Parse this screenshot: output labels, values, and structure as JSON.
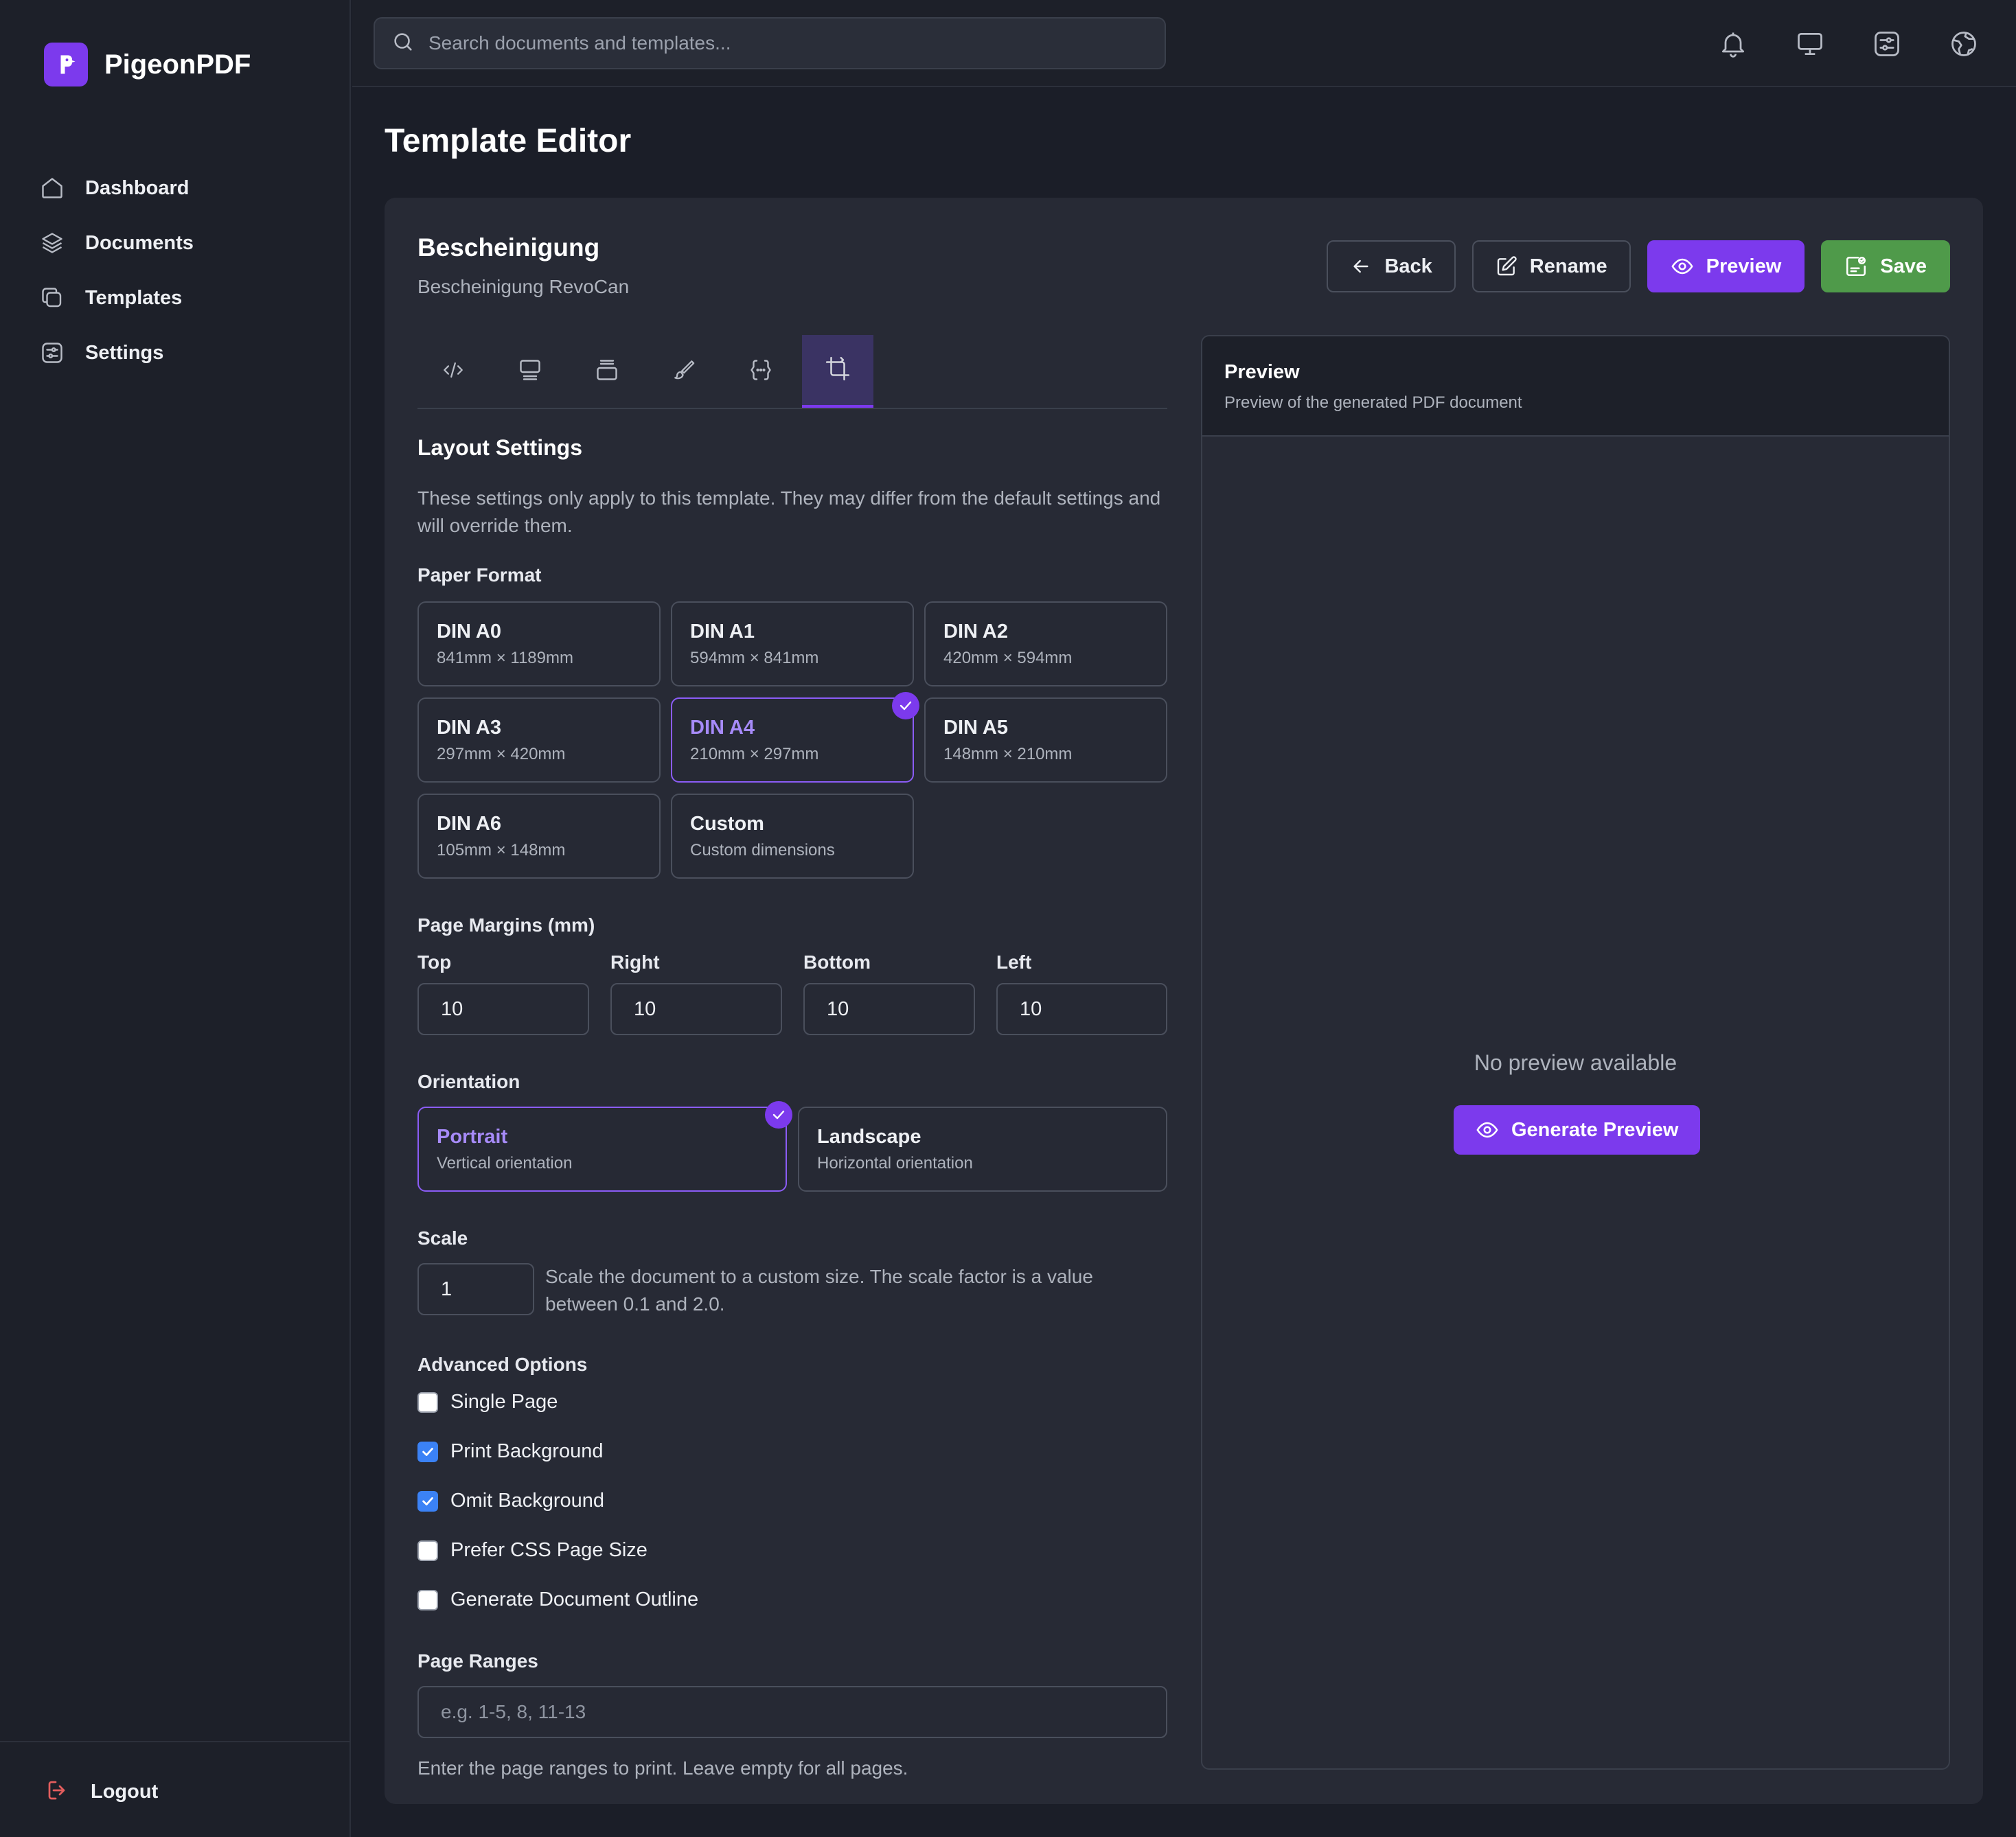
{
  "app": {
    "name": "PigeonPDF",
    "brand_color": "#7c3aed"
  },
  "sidebar": {
    "items": [
      {
        "label": "Dashboard",
        "icon": "home-icon"
      },
      {
        "label": "Documents",
        "icon": "layers-icon"
      },
      {
        "label": "Templates",
        "icon": "copy-icon"
      },
      {
        "label": "Settings",
        "icon": "sliders-icon"
      }
    ],
    "logout_label": "Logout"
  },
  "topbar": {
    "search_placeholder": "Search documents and templates...",
    "icons": [
      "bell-icon",
      "monitor-icon",
      "sliders-icon",
      "globe-icon"
    ]
  },
  "page": {
    "title": "Template Editor"
  },
  "template": {
    "name": "Bescheinigung",
    "description": "Bescheinigung RevoCan",
    "actions": {
      "back": "Back",
      "rename": "Rename",
      "preview": "Preview",
      "save": "Save"
    },
    "tabs": [
      {
        "icon": "code-icon",
        "active": false
      },
      {
        "icon": "header-icon",
        "active": false
      },
      {
        "icon": "footer-icon",
        "active": false
      },
      {
        "icon": "brush-icon",
        "active": false
      },
      {
        "icon": "variables-icon",
        "active": false
      },
      {
        "icon": "layout-icon",
        "active": true
      }
    ]
  },
  "layout": {
    "title": "Layout Settings",
    "description": "These settings only apply to this template. They may differ from the default settings and will override them.",
    "paper_format_label": "Paper Format",
    "formats": [
      {
        "name": "DIN A0",
        "dims": "841mm × 1189mm",
        "selected": false
      },
      {
        "name": "DIN A1",
        "dims": "594mm × 841mm",
        "selected": false
      },
      {
        "name": "DIN A2",
        "dims": "420mm × 594mm",
        "selected": false
      },
      {
        "name": "DIN A3",
        "dims": "297mm × 420mm",
        "selected": false
      },
      {
        "name": "DIN A4",
        "dims": "210mm × 297mm",
        "selected": true
      },
      {
        "name": "DIN A5",
        "dims": "148mm × 210mm",
        "selected": false
      },
      {
        "name": "DIN A6",
        "dims": "105mm × 148mm",
        "selected": false
      },
      {
        "name": "Custom",
        "dims": "Custom dimensions",
        "selected": false
      }
    ],
    "margins_label": "Page Margins (mm)",
    "margins": {
      "top_label": "Top",
      "top": "10",
      "right_label": "Right",
      "right": "10",
      "bottom_label": "Bottom",
      "bottom": "10",
      "left_label": "Left",
      "left": "10"
    },
    "orientation_label": "Orientation",
    "orientations": [
      {
        "name": "Portrait",
        "desc": "Vertical orientation",
        "selected": true
      },
      {
        "name": "Landscape",
        "desc": "Horizontal orientation",
        "selected": false
      }
    ],
    "scale_label": "Scale",
    "scale_value": "1",
    "scale_help": "Scale the document to a custom size. The scale factor is a value between 0.1 and 2.0.",
    "advanced_label": "Advanced Options",
    "advanced": [
      {
        "label": "Single Page",
        "checked": false
      },
      {
        "label": "Print Background",
        "checked": true
      },
      {
        "label": "Omit Background",
        "checked": true
      },
      {
        "label": "Prefer CSS Page Size",
        "checked": false
      },
      {
        "label": "Generate Document Outline",
        "checked": false
      }
    ],
    "page_ranges_label": "Page Ranges",
    "page_ranges_placeholder": "e.g. 1-5, 8, 11-13",
    "page_ranges_help": "Enter the page ranges to print. Leave empty for all pages."
  },
  "preview_panel": {
    "title": "Preview",
    "subtitle": "Preview of the generated PDF document",
    "empty_text": "No preview available",
    "generate_label": "Generate Preview"
  }
}
